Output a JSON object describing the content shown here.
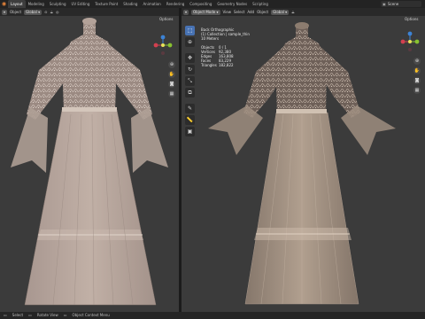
{
  "workspace_tabs": [
    "Layout",
    "Modeling",
    "Sculpting",
    "UV Editing",
    "Texture Paint",
    "Shading",
    "Animation",
    "Rendering",
    "Compositing",
    "Geometry Nodes",
    "Scripting"
  ],
  "active_tab": "Layout",
  "scene": "Scene",
  "left_viewport": {
    "header": {
      "mode": "Object",
      "orientation": "Global"
    },
    "options_label": "Options"
  },
  "right_viewport": {
    "header": {
      "mode": "Object Mode",
      "menus": [
        "View",
        "Select",
        "Add",
        "Object"
      ],
      "orientation": "Global"
    },
    "options_label": "Options",
    "overlay": {
      "view_name": "Back Orthographic",
      "collection": "(1) Collection | sample_thin",
      "units": "10 Meters",
      "stats": [
        {
          "key": "Objects",
          "value": "0 / 1"
        },
        {
          "key": "Vertices",
          "value": "92,380"
        },
        {
          "key": "Edges",
          "value": "163,808"
        },
        {
          "key": "Faces",
          "value": "83,229"
        },
        {
          "key": "Triangles",
          "value": "182,822"
        }
      ]
    }
  },
  "statusbar": [
    "Select",
    "Rotate View",
    "Object Context Menu"
  ],
  "colors": {
    "viewport_bg": "#3b3b3b",
    "dress_left": "#b3a299",
    "dress_right": "#b7a595",
    "active_tool": "#4772b3",
    "axis_x": "#d3404f",
    "axis_y": "#88c230",
    "axis_z": "#3c83d6"
  },
  "icons": [
    "cursor-icon",
    "move-icon",
    "rotate-icon",
    "scale-icon",
    "transform-icon",
    "annotate-icon",
    "measure-icon",
    "add-cube-icon",
    "zoom-icon",
    "hand-pan-icon",
    "camera-icon",
    "grid-icon"
  ]
}
